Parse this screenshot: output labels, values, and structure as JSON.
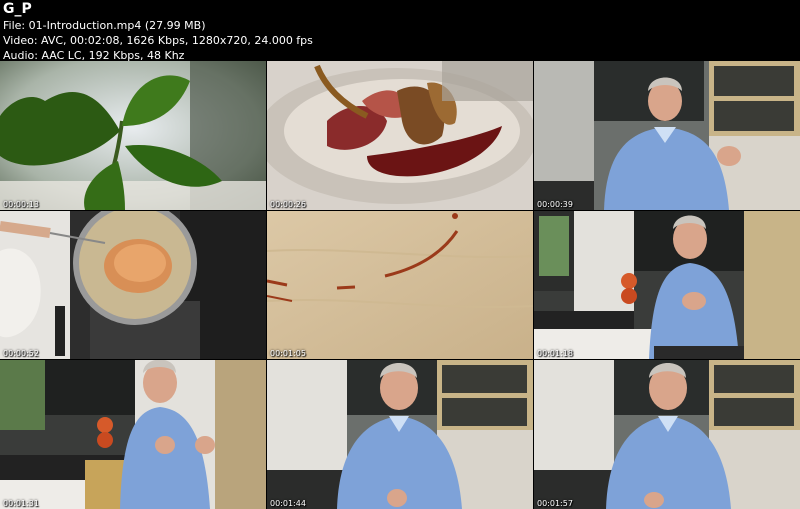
{
  "header": {
    "title": "G_P",
    "file": "File: 01-Introduction.mp4 (27.99 MB)",
    "video": "Video: AVC, 00:02:08, 1626 Kbps, 1280x720, 24.000 fps",
    "audio": "Audio: AAC LC, 192 Kbps, 48 Khz"
  },
  "thumbnails": [
    {
      "timestamp": "00:00:13",
      "subject": "fig-leaves"
    },
    {
      "timestamp": "00:00:26",
      "subject": "plated-duck-with-sauce"
    },
    {
      "timestamp": "00:00:39",
      "subject": "chef-speaking-kitchen"
    },
    {
      "timestamp": "00:00:52",
      "subject": "cutlet-in-pan"
    },
    {
      "timestamp": "00:01:05",
      "subject": "sauce-drips-on-board"
    },
    {
      "timestamp": "00:01:18",
      "subject": "chef-speaking-kitchen"
    },
    {
      "timestamp": "00:01:31",
      "subject": "chef-speaking-kitchen"
    },
    {
      "timestamp": "00:01:44",
      "subject": "chef-speaking-kitchen"
    },
    {
      "timestamp": "00:01:57",
      "subject": "chef-speaking-kitchen"
    }
  ]
}
